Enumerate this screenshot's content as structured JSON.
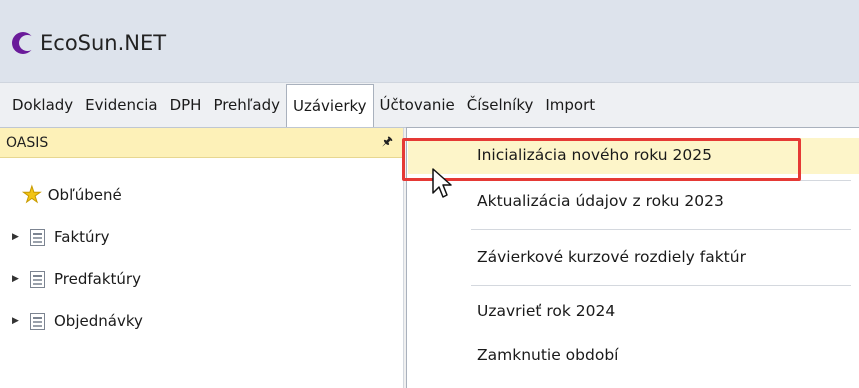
{
  "app": {
    "title": "EcoSun.NET",
    "logo_icon": "ecosun-logo-icon",
    "brand_color": "#6a1b9a"
  },
  "menubar": {
    "items": [
      {
        "label": "Doklady"
      },
      {
        "label": "Evidencia"
      },
      {
        "label": "DPH"
      },
      {
        "label": "Prehľady"
      },
      {
        "label": "Uzávierky",
        "active": true
      },
      {
        "label": "Účtovanie"
      },
      {
        "label": "Číselníky"
      },
      {
        "label": "Import"
      }
    ]
  },
  "panel": {
    "title": "OASIS",
    "pin_icon": "pin-icon",
    "tree": [
      {
        "label": "Obľúbené",
        "icon": "star-icon",
        "expandable": false
      },
      {
        "label": "Faktúry",
        "icon": "document-icon",
        "expandable": true
      },
      {
        "label": "Predfaktúry",
        "icon": "document-icon",
        "expandable": true
      },
      {
        "label": "Objednávky",
        "icon": "document-icon",
        "expandable": true
      }
    ]
  },
  "dropdown": {
    "items": [
      {
        "label": "Inicializácia nového roku 2025",
        "highlighted": true
      },
      {
        "label": "Aktualizácia údajov z roku 2023"
      },
      {
        "label": "Závierkové kurzové rozdiely faktúr"
      },
      {
        "label": "Uzavrieť rok 2024"
      },
      {
        "label": "Zamknutie období"
      }
    ],
    "highlight_color": "#e53935"
  }
}
